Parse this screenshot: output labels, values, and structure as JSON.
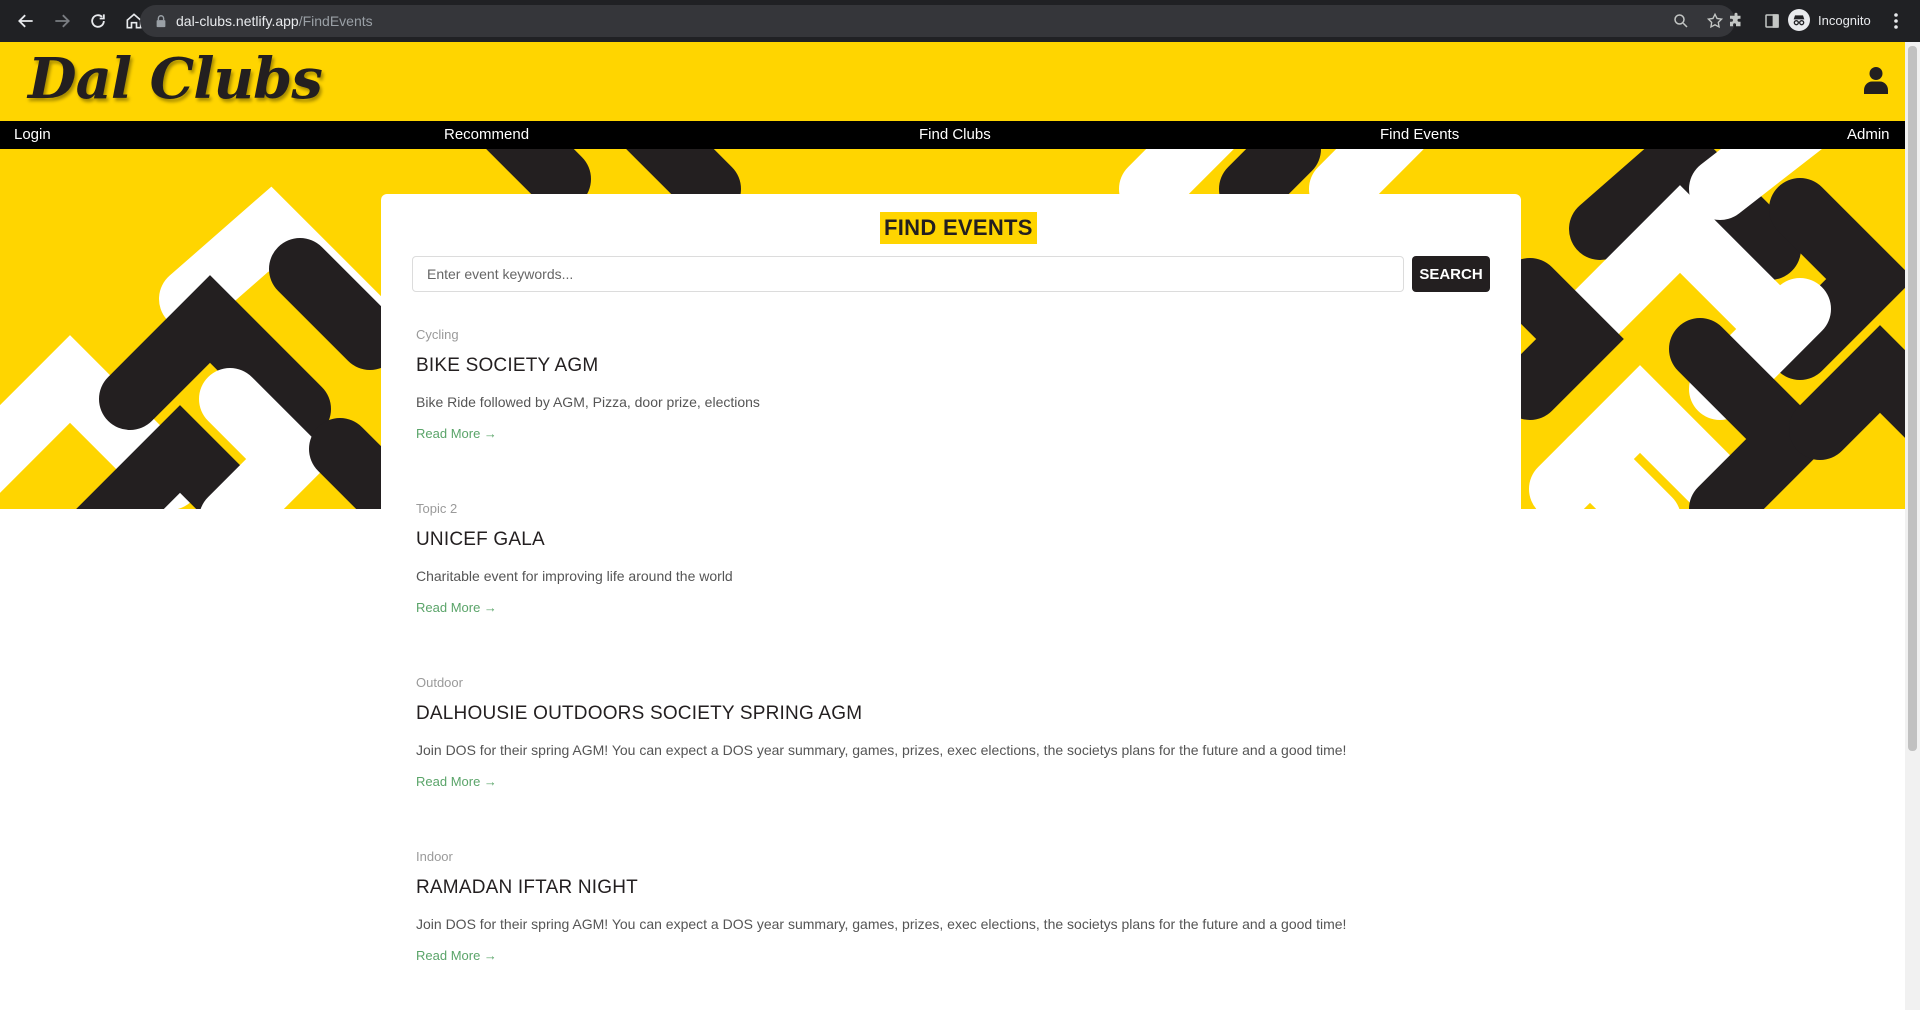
{
  "browser": {
    "url_host": "dal-clubs.netlify.app",
    "url_path": "/FindEvents",
    "profile_label": "Incognito"
  },
  "site": {
    "logo": "Dal Clubs",
    "nav": [
      {
        "label": "Login"
      },
      {
        "label": "Recommend"
      },
      {
        "label": "Find Clubs"
      },
      {
        "label": "Find Events"
      },
      {
        "label": "Admin"
      }
    ]
  },
  "main": {
    "title": "FIND EVENTS",
    "search": {
      "placeholder": "Enter event keywords...",
      "value": "",
      "button_label": "SEARCH"
    },
    "events": [
      {
        "topic": "Cycling",
        "title": "BIKE SOCIETY AGM",
        "description": "Bike Ride followed by AGM, Pizza, door prize, elections",
        "link": "Read More →"
      },
      {
        "topic": "Topic 2",
        "title": "UNICEF GALA",
        "description": "Charitable event for improving life around the world",
        "link": "Read More →"
      },
      {
        "topic": "Outdoor",
        "title": "DALHOUSIE OUTDOORS SOCIETY SPRING AGM",
        "description": "Join DOS for their spring AGM! You can expect a DOS year summary, games, prizes, exec elections, the societys plans for the future and a good time!",
        "link": "Read More →"
      },
      {
        "topic": "Indoor",
        "title": "RAMADAN IFTAR NIGHT",
        "description": "Join DOS for their spring AGM! You can expect a DOS year summary, games, prizes, exec elections, the societys plans for the future and a good time!",
        "link": "Read More →"
      }
    ]
  },
  "colors": {
    "brand_yellow": "#ffd500",
    "dark": "#231f20",
    "link_green": "#5aa469"
  }
}
